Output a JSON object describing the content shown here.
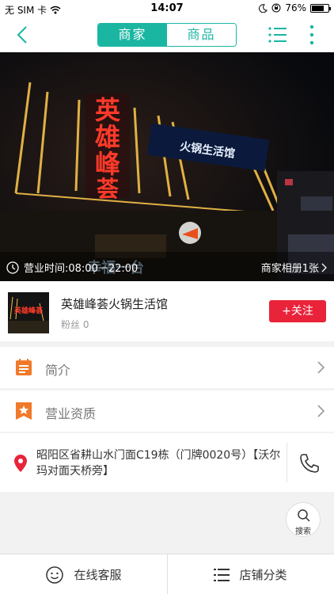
{
  "status_bar": {
    "carrier": "无 SIM 卡",
    "time": "14:07",
    "battery_percent": "76%",
    "battery_level": 0.76
  },
  "nav": {
    "tabs": [
      {
        "label": "商家",
        "active": true
      },
      {
        "label": "商品",
        "active": false
      }
    ]
  },
  "banner": {
    "sign_vertical": "英雄峰荟",
    "sign_side": "火锅生活馆",
    "sign_bottom": "幸福一台",
    "hours_label": "营业时间:08:00－22:00",
    "album_label": "商家相册1张"
  },
  "store": {
    "name": "英雄峰荟火锅生活馆",
    "fans_label": "粉丝",
    "fans_count": "0",
    "follow_label": "+关注",
    "thumb_text": "英雄峰荟"
  },
  "menu": [
    {
      "label": "简介",
      "icon": "list-icon"
    },
    {
      "label": "营业资质",
      "icon": "star-badge-icon"
    }
  ],
  "address": {
    "text": "昭阳区省耕山水门面C19栋（门牌0020号）【沃尔玛对面天桥旁】"
  },
  "search_float": {
    "label": "搜索"
  },
  "bottom_bar": {
    "chat_label": "在线客服",
    "category_label": "店铺分类"
  },
  "colors": {
    "accent": "#1ab6a2",
    "follow": "#e8233a",
    "icon_orange": "#f07a2a",
    "pin": "#e8233a"
  }
}
